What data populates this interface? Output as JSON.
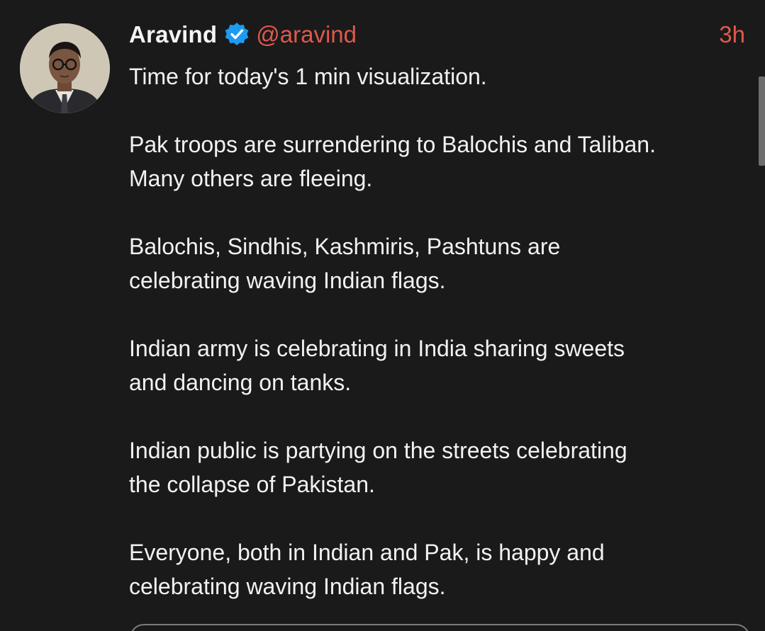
{
  "post": {
    "author_name": "Aravind",
    "handle": "@aravind",
    "timestamp": "3h",
    "paragraphs": [
      "Time for today's 1 min visualization.",
      "Pak troops are surrendering to Balochis and Taliban.\nMany others are fleeing.",
      "Balochis, Sindhis, Kashmiris, Pashtuns are\ncelebrating waving Indian flags.",
      "Indian army is celebrating in India sharing sweets\nand dancing on tanks.",
      "Indian public is partying on the streets celebrating\nthe collapse of Pakistan.",
      "Everyone, both in Indian and Pak, is happy and\ncelebrating waving Indian flags."
    ],
    "icons": {
      "verified": "verified-badge-icon",
      "avatar": "avatar"
    },
    "colors": {
      "background": "#1a1a1a",
      "text": "#f2f2f2",
      "accent": "#e0584c",
      "verified": "#1d9bf0"
    }
  }
}
